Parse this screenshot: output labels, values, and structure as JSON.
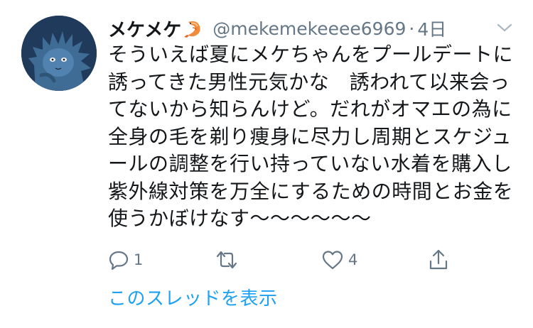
{
  "tweet": {
    "author": {
      "display_name": "メケメケ",
      "name_emoji": "shrimp-emoji",
      "handle": "@mekemekeeee6969",
      "avatar": "blue-cat-avatar-icon"
    },
    "separator": "·",
    "time": "4日",
    "menu_icon": "chevron-down-icon",
    "text_lines": [
      "そういえば夏にメケちゃんをプールデートに",
      "誘ってきた男性元気かな　誘われて以来会っ",
      "てないから知らんけど。だれがオマエの為に",
      "全身の毛を剃り痩身に尽力し周期とスケジュ",
      "ールの調整を行い持っていない水着を購入し",
      "紫外線対策を万全にするための時間とお金を",
      "使うかぼけなす〜〜〜〜〜〜"
    ],
    "actions": {
      "reply": {
        "icon": "reply-icon",
        "count": "1"
      },
      "retweet": {
        "icon": "retweet-icon",
        "count": ""
      },
      "like": {
        "icon": "heart-icon",
        "count": "4"
      },
      "share": {
        "icon": "share-icon"
      }
    },
    "show_thread_label": "このスレッドを表示"
  },
  "colors": {
    "text": "#14171a",
    "secondary": "#657786",
    "link": "#1da1f2",
    "background": "#ffffff"
  }
}
